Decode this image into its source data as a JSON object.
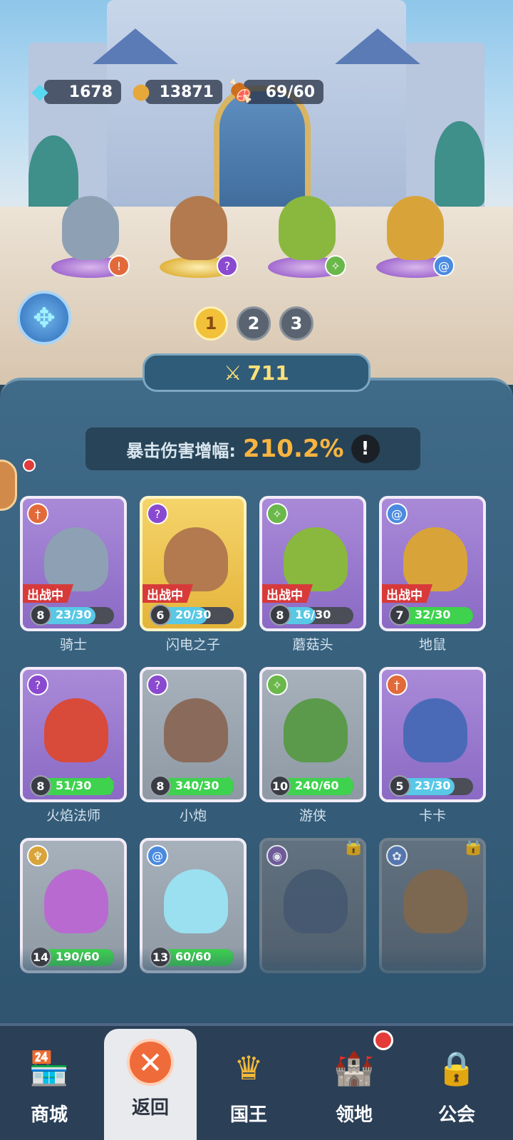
{
  "resources": {
    "diamonds": "1678",
    "gold": "13871",
    "stamina": "69/60"
  },
  "icons": {
    "diamond": "diamond-icon",
    "coin": "coin-icon",
    "meat": "meat-stamina-icon",
    "dpad": "dpad-icon",
    "sword": "sword-icon"
  },
  "team_pages": [
    "1",
    "2",
    "3"
  ],
  "active_page": "1",
  "power": "711",
  "crit": {
    "label": "暴击伤害增幅:",
    "value": "210.2%",
    "info": "!"
  },
  "deploy_tag": "出战中",
  "heroes": [
    {
      "name": "骑士",
      "level": "8",
      "fragments": "23/30",
      "progress": 0.77,
      "deployed": true,
      "class": "sword"
    },
    {
      "name": "闪电之子",
      "level": "6",
      "fragments": "20/30",
      "progress": 0.67,
      "deployed": true,
      "class": "wand"
    },
    {
      "name": "蘑菇头",
      "level": "8",
      "fragments": "16/30",
      "progress": 0.53,
      "deployed": true,
      "class": "bow"
    },
    {
      "name": "地鼠",
      "level": "7",
      "fragments": "32/30",
      "progress": 1.0,
      "deployed": true,
      "class": "spiral"
    },
    {
      "name": "火焰法师",
      "level": "8",
      "fragments": "51/30",
      "progress": 1.0,
      "deployed": false,
      "upgradable": true,
      "class": "wand"
    },
    {
      "name": "小炮",
      "level": "8",
      "fragments": "340/30",
      "progress": 1.0,
      "deployed": false,
      "upgradable": true,
      "class": "wand"
    },
    {
      "name": "游侠",
      "level": "10",
      "fragments": "240/60",
      "progress": 1.0,
      "deployed": false,
      "upgradable": true,
      "class": "bow"
    },
    {
      "name": "卡卡",
      "level": "5",
      "fragments": "23/30",
      "progress": 0.77,
      "deployed": false,
      "class": "sword"
    },
    {
      "name": "",
      "level": "14",
      "fragments": "190/60",
      "progress": 1.0,
      "deployed": false,
      "class": "wings"
    },
    {
      "name": "",
      "level": "13",
      "fragments": "60/60",
      "progress": 1.0,
      "deployed": false,
      "class": "spiral"
    },
    {
      "name": "",
      "locked": true,
      "class": "eye"
    },
    {
      "name": "",
      "locked": true,
      "class": "paw"
    }
  ],
  "nav": {
    "shop": "商城",
    "back": "返回",
    "king": "国王",
    "territory": "领地",
    "guild": "公会"
  },
  "colors": {
    "panel": "#2f5570",
    "deploy": "#d83a3a",
    "progress_full": "#3ed24e",
    "progress_partial": "#58c8e6",
    "crit_value": "#f9b440",
    "back_button": "#f06b3a"
  }
}
